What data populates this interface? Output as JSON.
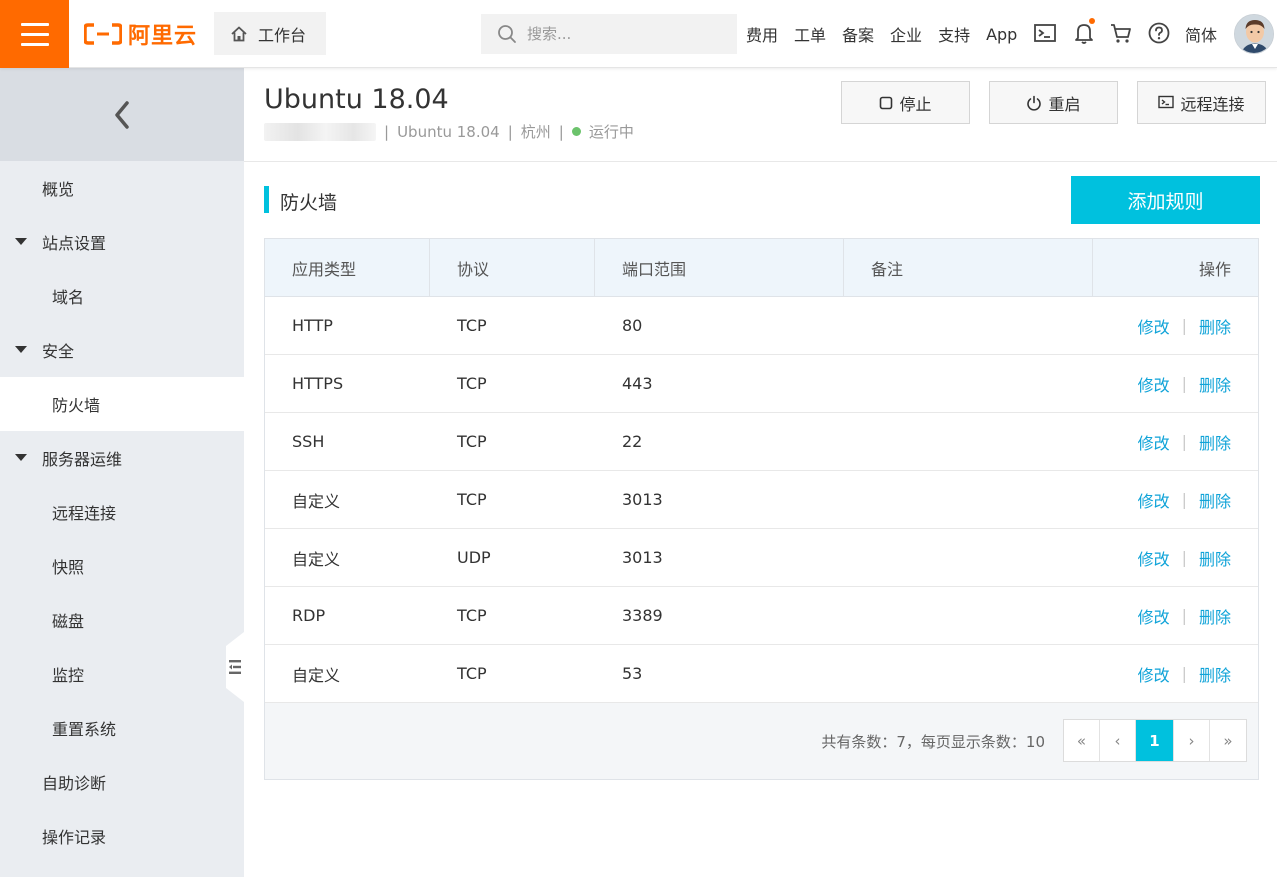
{
  "topbar": {
    "logo_text": "阿里云",
    "workbench_label": "工作台",
    "search_placeholder": "搜索...",
    "links": [
      "费用",
      "工单",
      "备案",
      "企业",
      "支持",
      "App"
    ],
    "language": "简体"
  },
  "sidebar": {
    "items": [
      {
        "label": "概览"
      },
      {
        "label": "站点设置"
      },
      {
        "label": "域名"
      },
      {
        "label": "安全"
      },
      {
        "label": "防火墙"
      },
      {
        "label": "服务器运维"
      },
      {
        "label": "远程连接"
      },
      {
        "label": "快照"
      },
      {
        "label": "磁盘"
      },
      {
        "label": "监控"
      },
      {
        "label": "重置系统"
      },
      {
        "label": "自助诊断"
      },
      {
        "label": "操作记录"
      }
    ]
  },
  "instance": {
    "title": "Ubuntu 18.04",
    "os": "Ubuntu 18.04",
    "region": "杭州",
    "status": "运行中",
    "status_color": "#6cc36c"
  },
  "actions": {
    "stop": "停止",
    "restart": "重启",
    "remote": "远程连接"
  },
  "section": {
    "title": "防火墙",
    "add_rule": "添加规则"
  },
  "table": {
    "headers": [
      "应用类型",
      "协议",
      "端口范围",
      "备注",
      "操作"
    ],
    "rows": [
      {
        "type": "HTTP",
        "protocol": "TCP",
        "port": "80",
        "note": "",
        "edit": "修改",
        "delete": "删除"
      },
      {
        "type": "HTTPS",
        "protocol": "TCP",
        "port": "443",
        "note": "",
        "edit": "修改",
        "delete": "删除"
      },
      {
        "type": "SSH",
        "protocol": "TCP",
        "port": "22",
        "note": "",
        "edit": "修改",
        "delete": "删除"
      },
      {
        "type": "自定义",
        "protocol": "TCP",
        "port": "3013",
        "note": "",
        "edit": "修改",
        "delete": "删除"
      },
      {
        "type": "自定义",
        "protocol": "UDP",
        "port": "3013",
        "note": "",
        "edit": "修改",
        "delete": "删除"
      },
      {
        "type": "RDP",
        "protocol": "TCP",
        "port": "3389",
        "note": "",
        "edit": "修改",
        "delete": "删除"
      },
      {
        "type": "自定义",
        "protocol": "TCP",
        "port": "53",
        "note": "",
        "edit": "修改",
        "delete": "删除"
      }
    ],
    "op_separator": "|",
    "summary": "共有条数：7，每页显示条数：10"
  },
  "pagination": {
    "first": "«",
    "prev": "‹",
    "current": "1",
    "next": "›",
    "last": "»"
  },
  "colors": {
    "brand": "#ff6a00",
    "accent": "#00c1de",
    "link": "#0fa3d8"
  }
}
